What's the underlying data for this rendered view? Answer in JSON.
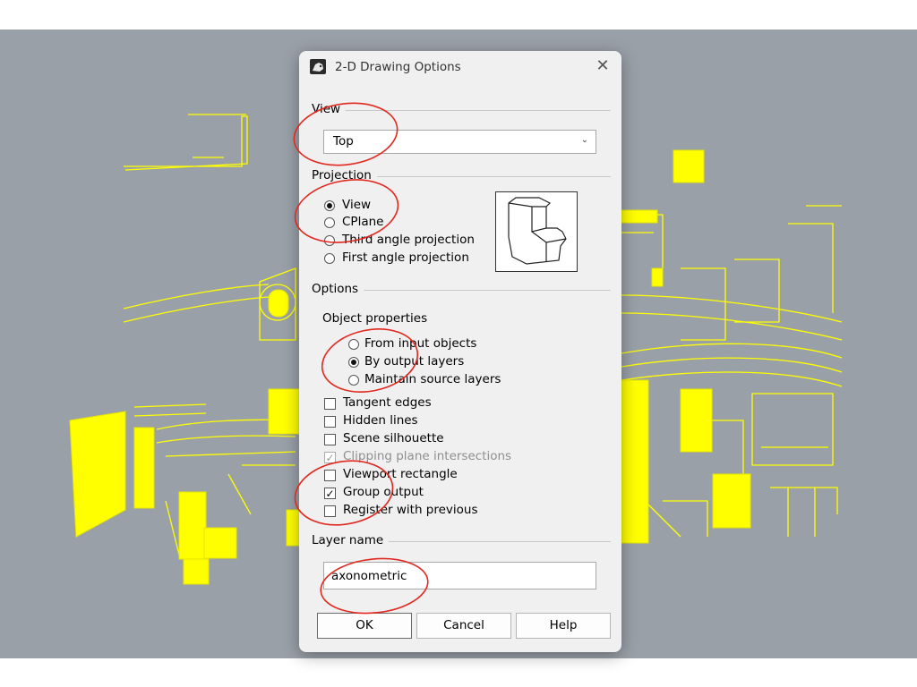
{
  "dialog": {
    "title": "2-D Drawing Options",
    "close_glyph": "✕"
  },
  "view": {
    "group_label": "View",
    "selected": "Top"
  },
  "projection": {
    "group_label": "Projection",
    "options": [
      {
        "label": "View",
        "selected": true
      },
      {
        "label": "CPlane",
        "selected": false
      },
      {
        "label": "Third angle projection",
        "selected": false
      },
      {
        "label": "First angle projection",
        "selected": false
      }
    ]
  },
  "options": {
    "group_label": "Options",
    "object_properties_label": "Object properties",
    "object_properties": [
      {
        "label": "From input objects",
        "selected": false
      },
      {
        "label": "By output layers",
        "selected": true
      },
      {
        "label": "Maintain source layers",
        "selected": false
      }
    ],
    "checks": [
      {
        "label": "Tangent edges",
        "checked": false,
        "enabled": true
      },
      {
        "label": "Hidden lines",
        "checked": false,
        "enabled": true
      },
      {
        "label": "Scene silhouette",
        "checked": false,
        "enabled": true
      },
      {
        "label": "Clipping plane intersections",
        "checked": true,
        "enabled": false
      },
      {
        "label": "Viewport rectangle",
        "checked": false,
        "enabled": true
      },
      {
        "label": "Group output",
        "checked": true,
        "enabled": true
      },
      {
        "label": "Register with previous",
        "checked": false,
        "enabled": true
      }
    ]
  },
  "layer_name": {
    "group_label": "Layer name",
    "value": "axonometric"
  },
  "buttons": {
    "ok": "OK",
    "cancel": "Cancel",
    "help": "Help"
  },
  "colors": {
    "viewport_bg": "#9aa0a8",
    "model_lines": "#ffff00",
    "annotation": "#e0281e"
  },
  "icons": {
    "dialog_icon": "rhino-icon",
    "close": "close-icon",
    "dropdown": "chevron-down-icon",
    "check": "checkmark-icon"
  }
}
